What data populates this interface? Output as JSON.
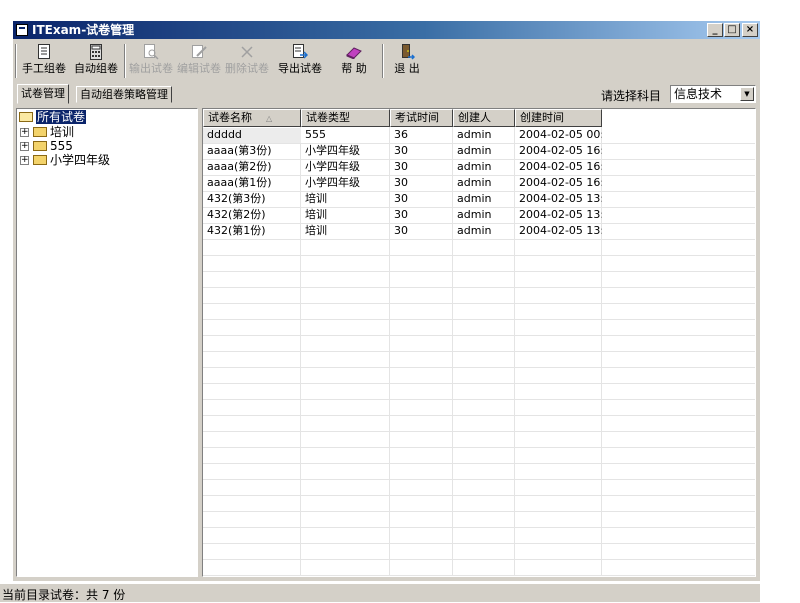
{
  "window": {
    "title": "ITExam-试卷管理"
  },
  "title_buttons": {
    "minimize": "_",
    "maximize": "□",
    "close": "×"
  },
  "toolbar": [
    {
      "name": "manual-compose-button",
      "icon": "document-icon",
      "label": "手工组卷",
      "enabled": true
    },
    {
      "name": "auto-compose-button",
      "icon": "calculator-icon",
      "label": "自动组卷",
      "enabled": true
    },
    {
      "name": "export-paper-button",
      "icon": "print-preview-icon",
      "label": "输出试卷",
      "enabled": false
    },
    {
      "name": "edit-paper-button",
      "icon": "edit-icon",
      "label": "编辑试卷",
      "enabled": false
    },
    {
      "name": "delete-paper-button",
      "icon": "delete-icon",
      "label": "删除试卷",
      "enabled": false
    },
    {
      "name": "import-paper-button",
      "icon": "import-icon",
      "label": "导出试卷",
      "enabled": true
    },
    {
      "name": "help-button",
      "icon": "book-icon",
      "label": "帮 助",
      "enabled": true
    },
    {
      "name": "exit-button",
      "icon": "door-exit-icon",
      "label": "退 出",
      "enabled": true
    }
  ],
  "tabs": [
    {
      "label": "试卷管理",
      "active": true
    },
    {
      "label": "自动组卷策略管理",
      "active": false
    }
  ],
  "subject": {
    "label": "请选择科目",
    "value": "信息技术"
  },
  "tree": {
    "root": "所有试卷",
    "children": [
      "培训",
      "555",
      "小学四年级"
    ]
  },
  "table": {
    "columns": [
      "试卷名称",
      "试卷类型",
      "考试时间",
      "创建人",
      "创建时间"
    ],
    "rows": [
      [
        "ddddd",
        "555",
        "36",
        "admin",
        "2004-02-05 00:..."
      ],
      [
        "aaaa(第3份)",
        "小学四年级",
        "30",
        "admin",
        "2004-02-05 16:..."
      ],
      [
        "aaaa(第2份)",
        "小学四年级",
        "30",
        "admin",
        "2004-02-05 16:..."
      ],
      [
        "aaaa(第1份)",
        "小学四年级",
        "30",
        "admin",
        "2004-02-05 16:..."
      ],
      [
        "432(第3份)",
        "培训",
        "30",
        "admin",
        "2004-02-05 13:..."
      ],
      [
        "432(第2份)",
        "培训",
        "30",
        "admin",
        "2004-02-05 13:..."
      ],
      [
        "432(第1份)",
        "培训",
        "30",
        "admin",
        "2004-02-05 13:..."
      ]
    ]
  },
  "status": {
    "text": "当前目录试卷：共 7 份"
  }
}
